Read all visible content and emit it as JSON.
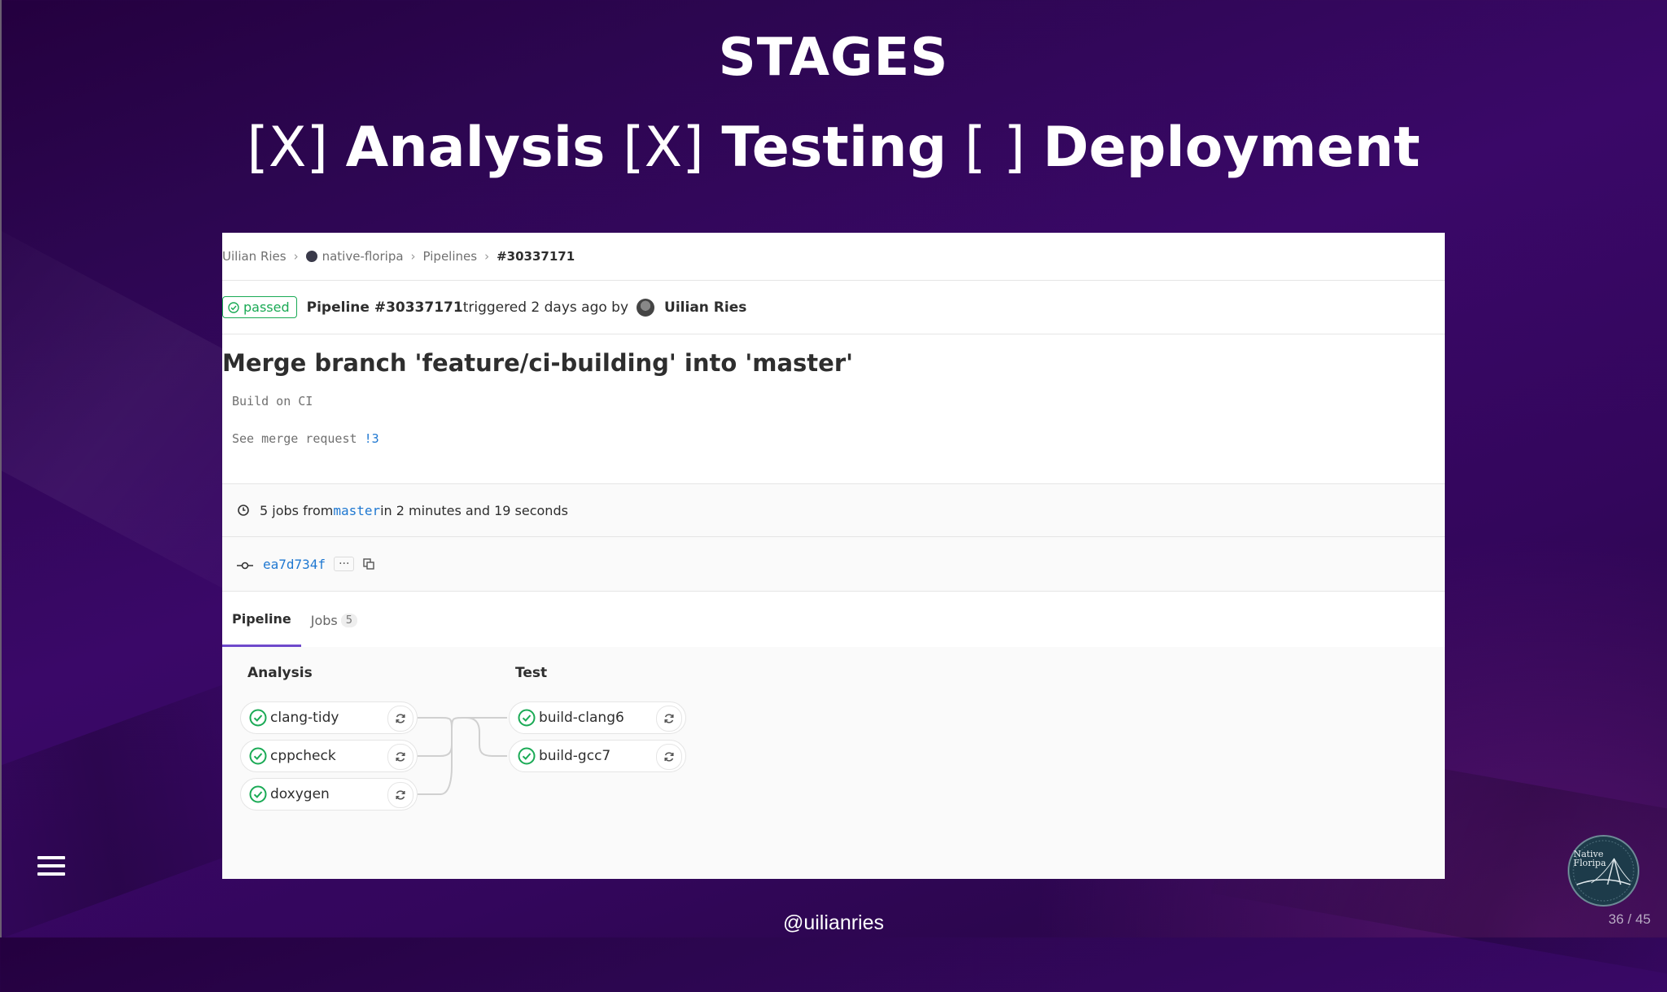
{
  "slide": {
    "title": "STAGES",
    "subtitle": {
      "mark1": "[X] ",
      "name1": "Analysis",
      "mark2": " [X] ",
      "name2": "Testing",
      "mark3": " [ ] ",
      "name3": "Deployment"
    },
    "handle": "@uilianries",
    "page_counter": "36 / 45",
    "logo_text": [
      "Native",
      "Floripa"
    ]
  },
  "breadcrumb": {
    "items": [
      "Uilian Ries",
      "native-floripa",
      "Pipelines"
    ],
    "current": "#30337171"
  },
  "pipeline_header": {
    "status": "passed",
    "pipeline_label": "Pipeline #30337171",
    "triggered_text": " triggered 2 days ago by",
    "user": "Uilian Ries"
  },
  "commit": {
    "title": "Merge branch 'feature/ci-building' into 'master'",
    "desc_line1": "Build on CI",
    "desc_line2_prefix": "See merge request ",
    "desc_line2_link": "!3"
  },
  "info": {
    "jobs_prefix": "5 jobs from ",
    "branch": "master",
    "jobs_suffix": " in 2 minutes and 19 seconds",
    "sha": "ea7d734f",
    "ellipsis": "···"
  },
  "tabs": {
    "pipeline": "Pipeline",
    "jobs": "Jobs",
    "jobs_count": "5"
  },
  "stages": [
    {
      "name": "Analysis",
      "jobs": [
        "clang-tidy",
        "cppcheck",
        "doxygen"
      ]
    },
    {
      "name": "Test",
      "jobs": [
        "build-clang6",
        "build-gcc7"
      ]
    }
  ],
  "colors": {
    "success": "#1aaa55",
    "link": "#1f78d1",
    "tab_active": "#6e49cb"
  }
}
